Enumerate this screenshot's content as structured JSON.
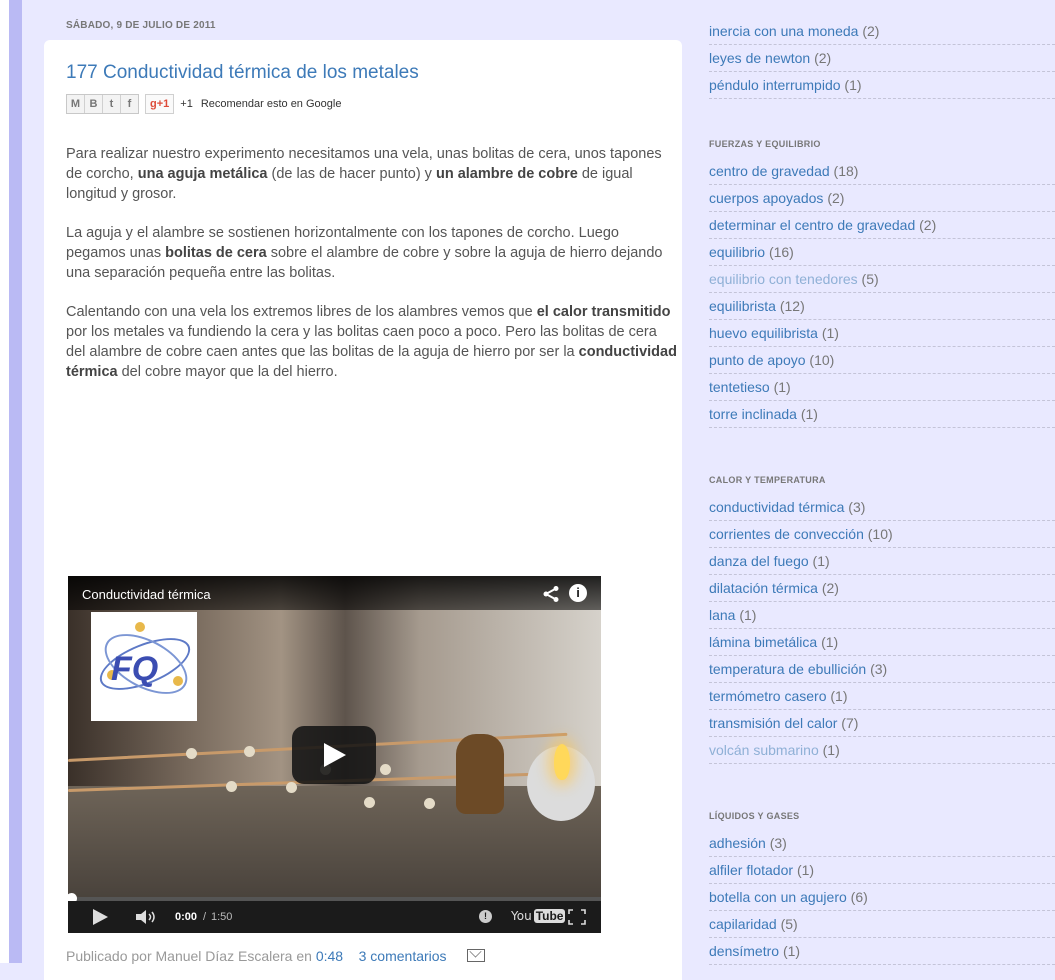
{
  "post": {
    "date_header": "SÁBADO, 9 DE JULIO DE 2011",
    "title": "177 Conductividad térmica de los metales",
    "share": {
      "email_glyph": "M",
      "blog_glyph": "B",
      "twitter_glyph": "t",
      "facebook_glyph": "f",
      "plusone_label": "g+1",
      "plusone_count": "+1",
      "recommend": "Recomendar esto en Google"
    },
    "paragraphs": [
      [
        {
          "t": "Para realizar nuestro experimento necesitamos una vela, unas bolitas de cera, unos tapones de corcho, "
        },
        {
          "t": "una aguja metálica",
          "b": true
        },
        {
          "t": " (de las de hacer punto) y "
        },
        {
          "t": "un alambre de cobre",
          "b": true
        },
        {
          "t": " de igual longitud y grosor."
        }
      ],
      [
        {
          "t": "La aguja y el alambre se sostienen horizontalmente con los tapones de corcho. Luego pegamos unas "
        },
        {
          "t": "bolitas de cera",
          "b": true
        },
        {
          "t": " sobre el alambre de cobre y sobre la aguja de hierro dejando una separación pequeña entre las bolitas."
        }
      ],
      [
        {
          "t": "Calentando con una vela los extremos libres de los alambres vemos que "
        },
        {
          "t": "el calor transmitido",
          "b": true
        },
        {
          "t": " por los metales va fundiendo la cera y las bolitas caen poco a poco. Pero las bolitas de cera del alambre de cobre caen antes que las bolitas de la aguja de hierro por ser la "
        },
        {
          "t": "conductividad térmica",
          "b": true
        },
        {
          "t": " del cobre mayor que la del hierro."
        }
      ]
    ],
    "video": {
      "title": "Conductividad térmica",
      "time_current": "0:00",
      "time_separator": "/",
      "time_total": "1:50",
      "progress": 0,
      "logo_text": "FQ",
      "youtube_you": "You",
      "youtube_tube": "Tube",
      "watch_later_glyph": "!",
      "info_glyph": "i"
    },
    "footer": {
      "published_by": "Publicado por Manuel Díaz Escalera en ",
      "time_link": "0:48",
      "comments_link": "3 comentarios"
    }
  },
  "sidebar": {
    "widgets": [
      {
        "title": "",
        "items": [
          {
            "label": "inercia con una moneda",
            "count": "(2)"
          },
          {
            "label": "leyes de newton",
            "count": "(2)"
          },
          {
            "label": "péndulo interrumpido",
            "count": "(1)"
          }
        ]
      },
      {
        "title": "FUERZAS Y EQUILIBRIO",
        "items": [
          {
            "label": "centro de gravedad",
            "count": "(18)"
          },
          {
            "label": "cuerpos apoyados",
            "count": "(2)"
          },
          {
            "label": "determinar el centro de gravedad",
            "count": "(2)"
          },
          {
            "label": "equilibrio",
            "count": "(16)"
          },
          {
            "label": "equilibrio con tenedores",
            "count": "(5)",
            "visited": true
          },
          {
            "label": "equilibrista",
            "count": "(12)"
          },
          {
            "label": "huevo equilibrista",
            "count": "(1)"
          },
          {
            "label": "punto de apoyo",
            "count": "(10)"
          },
          {
            "label": "tentetieso",
            "count": "(1)"
          },
          {
            "label": "torre inclinada",
            "count": "(1)"
          }
        ]
      },
      {
        "title": "CALOR Y TEMPERATURA",
        "items": [
          {
            "label": "conductividad térmica",
            "count": "(3)"
          },
          {
            "label": "corrientes de convección",
            "count": "(10)"
          },
          {
            "label": "danza del fuego",
            "count": "(1)"
          },
          {
            "label": "dilatación térmica",
            "count": "(2)"
          },
          {
            "label": "lana",
            "count": "(1)"
          },
          {
            "label": "lámina bimetálica",
            "count": "(1)"
          },
          {
            "label": "temperatura de ebullición",
            "count": "(3)"
          },
          {
            "label": "termómetro casero",
            "count": "(1)"
          },
          {
            "label": "transmisión del calor",
            "count": "(7)"
          },
          {
            "label": "volcán submarino",
            "count": "(1)",
            "visited": true
          }
        ]
      },
      {
        "title": "LÍQUIDOS Y GASES",
        "items": [
          {
            "label": "adhesión",
            "count": "(3)"
          },
          {
            "label": "alfiler flotador",
            "count": "(1)"
          },
          {
            "label": "botella con un agujero",
            "count": "(6)"
          },
          {
            "label": "capilaridad",
            "count": "(5)"
          },
          {
            "label": "densímetro",
            "count": "(1)"
          }
        ]
      }
    ]
  },
  "colors": {
    "page_background": "#e9e9ff",
    "left_bar": "#babaf4",
    "link": "#3d7ab8",
    "visited_link": "#8fb0d6",
    "text": "#555555"
  }
}
